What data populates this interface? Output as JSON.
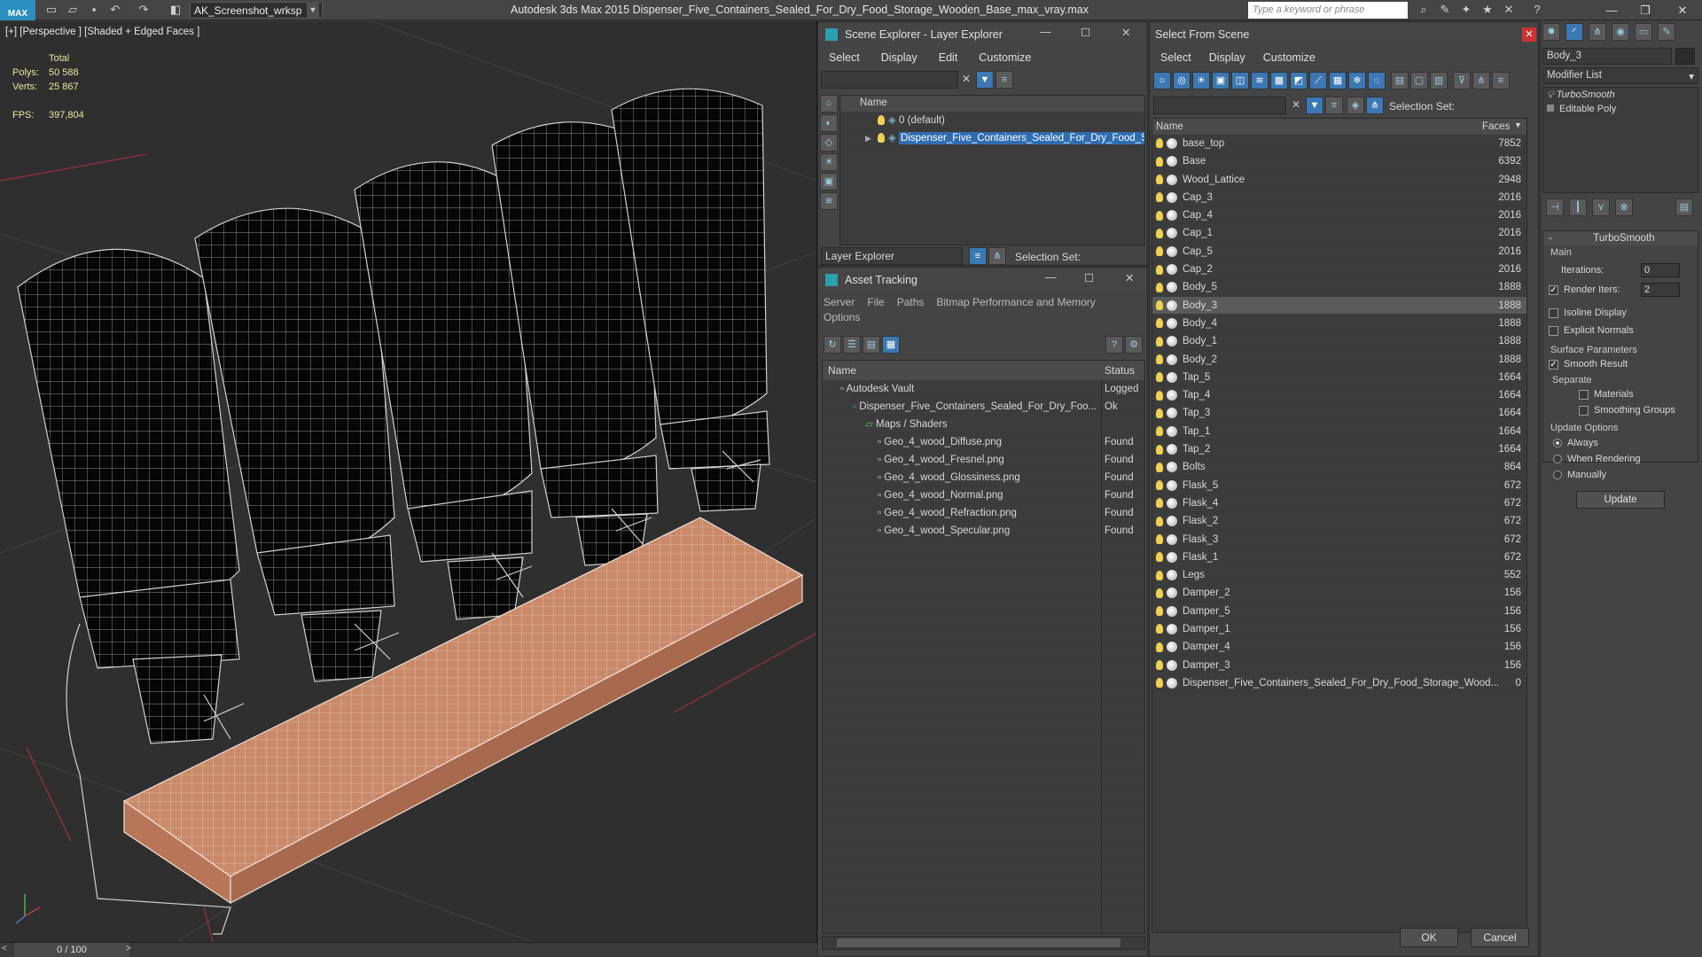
{
  "app": {
    "logo": "MAX",
    "workspace": "AK_Screenshot_wrksp",
    "title": "Autodesk 3ds Max  2015    Dispenser_Five_Containers_Sealed_For_Dry_Food_Storage_Wooden_Base_max_vray.max",
    "search_placeholder": "Type a keyword or phrase"
  },
  "viewport": {
    "label": "[+] [Perspective ] [Shaded + Edged Faces ]",
    "stats": {
      "total_label": "Total",
      "polys_label": "Polys:",
      "polys": "50 588",
      "verts_label": "Verts:",
      "verts": "25 867",
      "fps_label": "FPS:",
      "fps": "397,804"
    },
    "timeline": "0 / 100"
  },
  "layer_explorer": {
    "title": "Scene Explorer - Layer Explorer",
    "menu": [
      "Select",
      "Display",
      "Edit",
      "Customize"
    ],
    "column": "Name",
    "layers": [
      "0 (default)",
      "Dispenser_Five_Containers_Sealed_For_Dry_Food_Stora..."
    ],
    "footer_dropdown": "Layer Explorer",
    "selection_set": "Selection Set:"
  },
  "asset_tracking": {
    "title": "Asset Tracking",
    "menu1": [
      "Server",
      "File",
      "Paths",
      "Bitmap Performance and Memory"
    ],
    "menu2": "Options",
    "columns": {
      "name": "Name",
      "status": "Status"
    },
    "rows": [
      {
        "name": "Autodesk Vault",
        "status": "Logged",
        "indent": 0
      },
      {
        "name": "Dispenser_Five_Containers_Sealed_For_Dry_Foo...",
        "status": "Ok",
        "indent": 1
      },
      {
        "name": "Maps / Shaders",
        "status": "",
        "indent": 2
      },
      {
        "name": "Geo_4_wood_Diffuse.png",
        "status": "Found",
        "indent": 3
      },
      {
        "name": "Geo_4_wood_Fresnel.png",
        "status": "Found",
        "indent": 3
      },
      {
        "name": "Geo_4_wood_Glossiness.png",
        "status": "Found",
        "indent": 3
      },
      {
        "name": "Geo_4_wood_Normal.png",
        "status": "Found",
        "indent": 3
      },
      {
        "name": "Geo_4_wood_Refraction.png",
        "status": "Found",
        "indent": 3
      },
      {
        "name": "Geo_4_wood_Specular.png",
        "status": "Found",
        "indent": 3
      }
    ]
  },
  "select_from_scene": {
    "title": "Select From Scene",
    "menu": [
      "Select",
      "Display",
      "Customize"
    ],
    "selection_set": "Selection Set:",
    "columns": {
      "name": "Name",
      "faces": "Faces"
    },
    "rows": [
      {
        "name": "base_top",
        "faces": "7852"
      },
      {
        "name": "Base",
        "faces": "6392"
      },
      {
        "name": "Wood_Lattice",
        "faces": "2948"
      },
      {
        "name": "Cap_3",
        "faces": "2016"
      },
      {
        "name": "Cap_4",
        "faces": "2016"
      },
      {
        "name": "Cap_1",
        "faces": "2016"
      },
      {
        "name": "Cap_5",
        "faces": "2016"
      },
      {
        "name": "Cap_2",
        "faces": "2016"
      },
      {
        "name": "Body_5",
        "faces": "1888"
      },
      {
        "name": "Body_3",
        "faces": "1888"
      },
      {
        "name": "Body_4",
        "faces": "1888"
      },
      {
        "name": "Body_1",
        "faces": "1888"
      },
      {
        "name": "Body_2",
        "faces": "1888"
      },
      {
        "name": "Tap_5",
        "faces": "1664"
      },
      {
        "name": "Tap_4",
        "faces": "1664"
      },
      {
        "name": "Tap_3",
        "faces": "1664"
      },
      {
        "name": "Tap_1",
        "faces": "1664"
      },
      {
        "name": "Tap_2",
        "faces": "1664"
      },
      {
        "name": "Bolts",
        "faces": "864"
      },
      {
        "name": "Flask_5",
        "faces": "672"
      },
      {
        "name": "Flask_4",
        "faces": "672"
      },
      {
        "name": "Flask_2",
        "faces": "672"
      },
      {
        "name": "Flask_3",
        "faces": "672"
      },
      {
        "name": "Flask_1",
        "faces": "672"
      },
      {
        "name": "Legs",
        "faces": "552"
      },
      {
        "name": "Damper_2",
        "faces": "156"
      },
      {
        "name": "Damper_5",
        "faces": "156"
      },
      {
        "name": "Damper_1",
        "faces": "156"
      },
      {
        "name": "Damper_4",
        "faces": "156"
      },
      {
        "name": "Damper_3",
        "faces": "156"
      },
      {
        "name": "Dispenser_Five_Containers_Sealed_For_Dry_Food_Storage_Wood...",
        "faces": "0"
      }
    ],
    "selected_row": "Body_3",
    "ok": "OK",
    "cancel": "Cancel"
  },
  "modify_panel": {
    "object_name": "Body_3",
    "modifier_list": "Modifier List",
    "stack": [
      "TurboSmooth",
      "Editable Poly"
    ],
    "rollout": "TurboSmooth",
    "main": "Main",
    "iterations_label": "Iterations:",
    "iterations": "0",
    "render_iters_label": "Render Iters:",
    "render_iters": "2",
    "isoline": "Isoline Display",
    "explicit": "Explicit Normals",
    "surface": "Surface Parameters",
    "smooth": "Smooth Result",
    "separate": "Separate",
    "materials": "Materials",
    "smoothing": "Smoothing Groups",
    "update_options": "Update Options",
    "always": "Always",
    "when_rendering": "When Rendering",
    "manually": "Manually",
    "update": "Update"
  },
  "colors": {
    "accent": "#3c78b4",
    "wood": "#c98a6a",
    "selected": "#5a5a5a"
  }
}
